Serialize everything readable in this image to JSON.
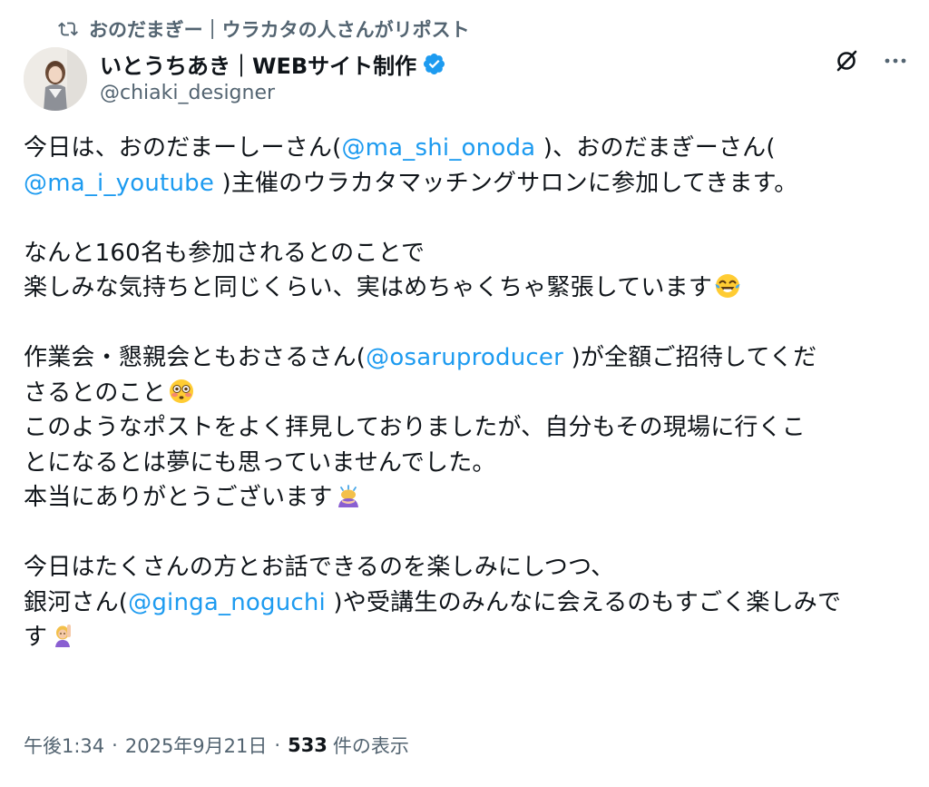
{
  "repost": {
    "icon": "repost-icon",
    "text": "おのだまぎー｜ウラカタの人さんがリポスト"
  },
  "author": {
    "display_name": "いとうちあき｜WEBサイト制作",
    "handle": "@chiaki_designer",
    "verified": true,
    "verified_color": "#1d9bf0"
  },
  "actions": {
    "grok_icon": "grok-icon",
    "more_icon": "more-icon"
  },
  "tweet": {
    "p1": {
      "l1a": "今日は、おのだまーしーさん(",
      "m1": "@ma_shi_onoda",
      "l1b": " )、おのだまぎーさん(",
      "m2": "@ma_i_youtube",
      "l2b": " )主催のウラカタマッチングサロンに参加してきます。"
    },
    "p2": {
      "l1": "なんと160名も参加されるとのことで",
      "l2": "楽しみな気持ちと同じくらい、実はめちゃくちゃ緊張しています",
      "emoji": "tears-of-joy-emoji"
    },
    "p3": {
      "l1a": "作業会・懇親会ともおさるさん(",
      "m1": "@osaruproducer",
      "l1b": " )が全額ご招待してくだ",
      "l2": "さるとのこと",
      "emoji1": "flushed-face-emoji",
      "l3": "このようなポストをよく拝見しておりましたが、自分もその現場に行くこ",
      "l4": "とになるとは夢にも思っていませんでした。",
      "l5": "本当にありがとうございます",
      "emoji2": "bowing-woman-emoji"
    },
    "p4": {
      "l1": "今日はたくさんの方とお話できるのを楽しみにしつつ、",
      "l2a": "銀河さん(",
      "m1": "@ginga_noguchi",
      "l2b": " )や受講生のみんなに会えるのもすごく楽しみで",
      "l3": "す",
      "emoji": "raising-hand-woman-emoji"
    }
  },
  "meta": {
    "time": "午後1:34",
    "sep": "·",
    "date": "2025年9月21日",
    "views_count": "533",
    "views_label": "件の表示"
  },
  "colors": {
    "link": "#1d9bf0",
    "secondary_text": "#536471",
    "primary_text": "#0f1419"
  }
}
